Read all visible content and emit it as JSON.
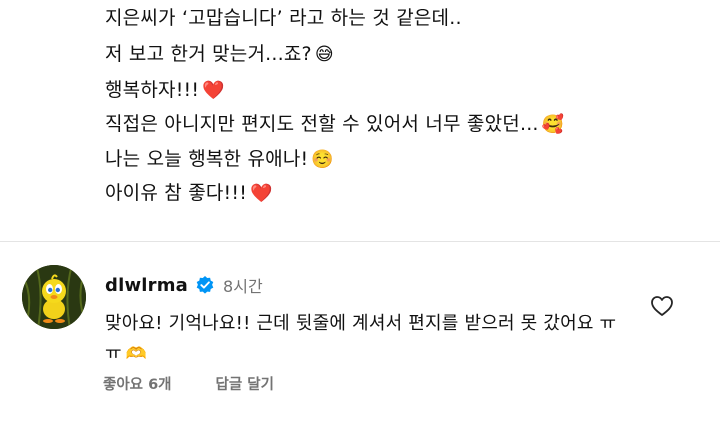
{
  "post": {
    "lines": [
      {
        "text": "지은씨가 ‘고맙습니다’ 라고 하는 것 같은데..",
        "emoji": ""
      },
      {
        "text": "저 보고 한거 맞는거...죠?",
        "emoji": "😅"
      },
      {
        "text": "행복하자!!!",
        "emoji": "❤️"
      },
      {
        "text": "직접은 아니지만 편지도 전할 수 있어서 너무 좋았던...",
        "emoji": "🥰"
      },
      {
        "text": "나는 오늘 행복한 유애나!",
        "emoji": "☺️"
      },
      {
        "text": "아이유 참 좋다!!!",
        "emoji": "❤️"
      }
    ]
  },
  "comment": {
    "username": "dlwlrma",
    "verified": true,
    "time": "8시간",
    "text": "맞아요! 기억나요!! 근데 뒷줄에 계셔서 편지를 받으러 못 갔어요 ㅠㅠ",
    "emoji": "🫶",
    "likes": "좋아요 6개",
    "reply": "답글 달기",
    "icons": {
      "verified": "verified-badge-icon",
      "like": "heart-outline-icon",
      "avatar": "tweety-bird-avatar"
    },
    "colors": {
      "verified": "#0095f6",
      "muted": "#737373"
    }
  }
}
